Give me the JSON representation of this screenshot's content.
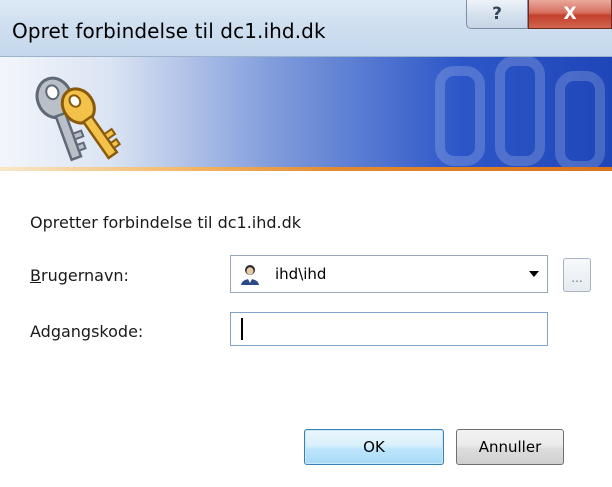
{
  "window": {
    "title": "Opret forbindelse til dc1.ihd.dk",
    "help_glyph": "?",
    "close_glyph": "X"
  },
  "banner": {
    "icon": "keys-icon"
  },
  "dialog": {
    "connecting_text": "Opretter forbindelse til dc1.ihd.dk",
    "username_label_first": "B",
    "username_label_rest": "rugernavn:",
    "username_value": "ihd\\ihd",
    "password_label_first": "Ad",
    "password_label_accel": "g",
    "password_label_rest": "angskode:",
    "password_value": "",
    "browse_label": "..."
  },
  "buttons": {
    "ok": "OK",
    "cancel": "Annuller"
  },
  "colors": {
    "banner_dark": "#1f46b8",
    "accent_stripe": "#e28a2e",
    "close_red": "#c2402c"
  }
}
